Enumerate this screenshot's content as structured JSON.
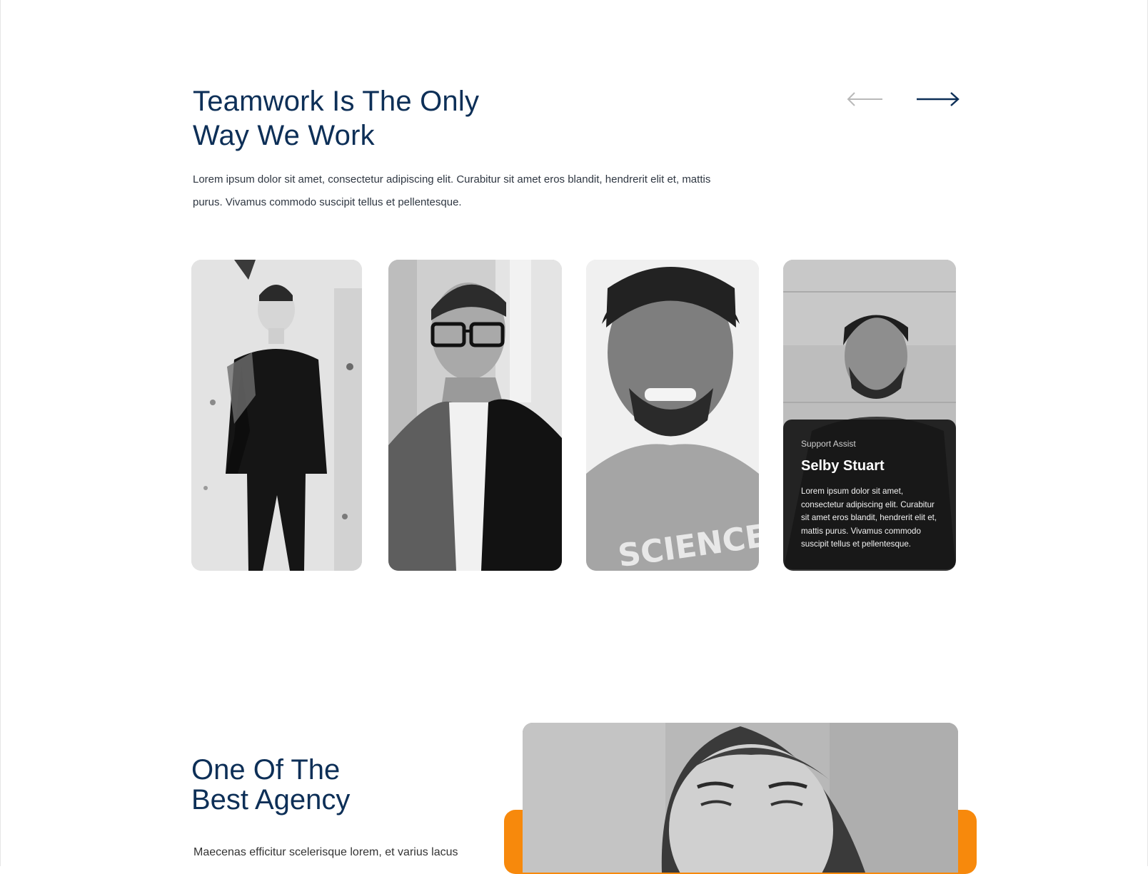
{
  "team_section": {
    "title_line1": "Teamwork Is The Only",
    "title_line2": "Way We Work",
    "description": "Lorem ipsum dolor sit amet, consectetur adipiscing elit. Curabitur sit amet eros blandit, hendrerit elit et, mattis purus. Vivamus commodo suscipit tellus et pellentesque.",
    "nav": {
      "prev_icon": "arrow-left-icon",
      "next_icon": "arrow-right-icon",
      "prev_color": "#b9b9b9",
      "next_color": "#0d2f57"
    },
    "members": [
      {
        "photo": "man-with-climbing-gear"
      },
      {
        "photo": "man-in-glasses-and-blazer"
      },
      {
        "photo": "smiling-man-in-science-tshirt"
      },
      {
        "photo": "smiling-bearded-man",
        "role": "Support Assist",
        "name": "Selby Stuart",
        "bio": "Lorem ipsum dolor sit amet, consectetur adipiscing elit. Curabitur sit amet eros blandit, hendrerit elit et, mattis purus. Vivamus commodo suscipit tellus et pellentesque."
      }
    ]
  },
  "agency_section": {
    "title_line1": "One Of The",
    "title_line2": "Best Agency",
    "description": "Maecenas efficitur scelerisque lorem, et varius lacus",
    "photo": "smiling-woman",
    "accent_color": "#f7890c"
  },
  "colors": {
    "heading": "#0d2f57",
    "body_text": "#2f3742",
    "overlay": "#161616"
  }
}
